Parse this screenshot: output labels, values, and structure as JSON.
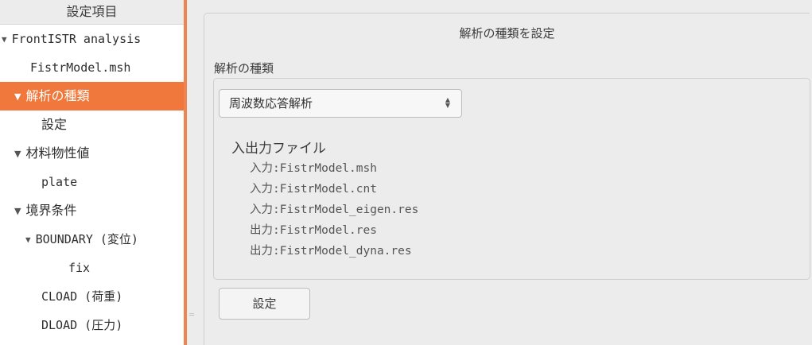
{
  "tree": {
    "header": "設定項目",
    "items": [
      {
        "arrow": "▼",
        "label": "FrontISTR analysis",
        "mono": true
      },
      {
        "arrow": "",
        "label": "FistrModel.msh",
        "mono": true
      },
      {
        "arrow": "▼",
        "label": "解析の種類",
        "mono": false,
        "selected": true
      },
      {
        "arrow": "",
        "label": "設定",
        "mono": false
      },
      {
        "arrow": "▼",
        "label": "材料物性値",
        "mono": false
      },
      {
        "arrow": "",
        "label": "plate",
        "mono": true
      },
      {
        "arrow": "▼",
        "label": "境界条件",
        "mono": false
      },
      {
        "arrow": "▼",
        "label": "BOUNDARY (変位)",
        "mono": true
      },
      {
        "arrow": "",
        "label": "fix",
        "mono": true
      },
      {
        "arrow": "",
        "label": "CLOAD (荷重)",
        "mono": true
      },
      {
        "arrow": "",
        "label": "DLOAD (圧力)",
        "mono": true
      }
    ]
  },
  "main": {
    "title": "解析の種類を設定",
    "group_title": "解析の種類",
    "combo_value": "周波数応答解析",
    "io_title": "入出力ファイル",
    "io_lines": [
      "入力:FistrModel.msh",
      "入力:FistrModel.cnt",
      "入力:FistrModel_eigen.res",
      "出力:FistrModel.res",
      "出力:FistrModel_dyna.res"
    ],
    "set_button": "設定"
  },
  "colors": {
    "accent": "#f0783c",
    "panel_bg": "#ececec",
    "tree_bg": "#ffffff"
  }
}
